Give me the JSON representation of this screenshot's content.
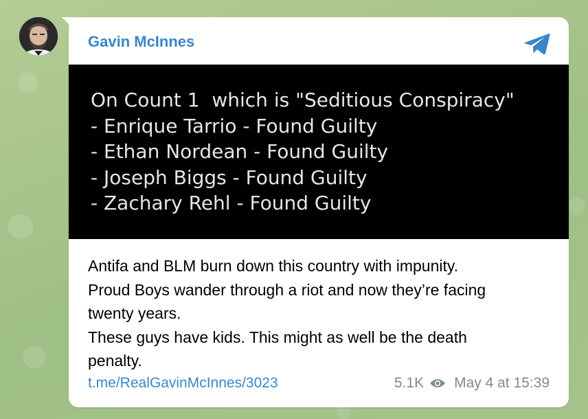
{
  "channel": {
    "name": "Gavin McInnes"
  },
  "post": {
    "image_text": [
      "On Count 1  which is \"Seditious Conspiracy\"",
      "- Enrique Tarrio - Found Guilty",
      "- Ethan Nordean - Found Guilty",
      "- Joseph Biggs - Found Guilty",
      "- Zachary Rehl - Found Guilty"
    ],
    "caption_lines": [
      "Antifa and BLM burn down this country with impunity.",
      "Proud Boys wander through a riot and now they’re facing",
      "twenty years.",
      "These guys have kids. This might as well be the death",
      "penalty."
    ],
    "link": "t.me/RealGavinMcInnes/3023",
    "views": "5.1K",
    "date": "May 4 at 15:39"
  },
  "icons": {
    "share": "telegram-plane-icon",
    "views": "eye-icon"
  },
  "colors": {
    "accent": "#3a86c8",
    "meta": "#7d8a94",
    "background": "#a9c48d"
  }
}
